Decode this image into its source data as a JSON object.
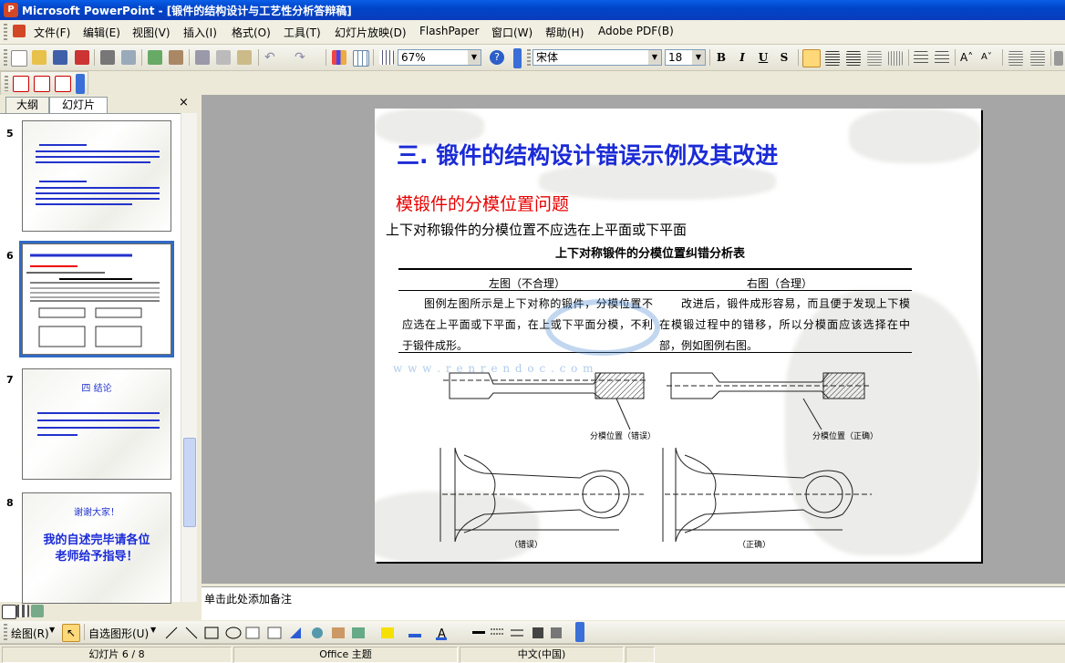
{
  "window": {
    "title": "Microsoft PowerPoint - [锻件的结构设计与工艺性分析答辩稿]"
  },
  "menu": [
    "文件(F)",
    "编辑(E)",
    "视图(V)",
    "插入(I)",
    "格式(O)",
    "工具(T)",
    "幻灯片放映(D)",
    "FlashPaper",
    "窗口(W)",
    "帮助(H)",
    "Adobe PDF(B)"
  ],
  "toolbar": {
    "zoom": "67%",
    "font": "宋体",
    "font_size": "18"
  },
  "format_buttons": {
    "bold": "B",
    "italic": "I",
    "underline": "U",
    "shadow": "S"
  },
  "pane_tabs": {
    "outline": "大纲",
    "slides": "幻灯片"
  },
  "thumbnails": [
    {
      "num": "5"
    },
    {
      "num": "6"
    },
    {
      "num": "7",
      "title": "四 结论"
    },
    {
      "num": "8",
      "line1": "谢谢大家！",
      "line2": "我的自述完毕请各位",
      "line3": "老师给予指导！"
    }
  ],
  "slide": {
    "title": "三. 锻件的结构设计错误示例及其改进",
    "subtitle": "模锻件的分模位置问题",
    "intro": "上下对称锻件的分模位置不应选在上平面或下平面",
    "table_title": "上下对称锻件的分模位置纠错分析表",
    "col_left": "左图（不合理）",
    "col_right": "右图（合理）",
    "left_text": "图例左图所示是上下对称的锻件，分模位置不应选在上平面或下平面，在上或下平面分模，不利于锻件成形。",
    "right_text": "改进后，锻件成形容易，而且便于发现上下模在模锻过程中的错移，所以分模面应该选择在中部，例如图例右图。",
    "label_wrong_pos": "分模位置（错误）",
    "label_right_pos": "分模位置（正确）",
    "caption_wrong": "（错误）",
    "caption_right": "（正确）",
    "watermark": "w w w . r e n r e n d o c . c o m"
  },
  "notes": {
    "placeholder": "单击此处添加备注"
  },
  "drawbar": {
    "draw": "绘图(R)",
    "autoshapes": "自选图形(U)"
  },
  "status": {
    "slide": "幻灯片 6 / 8",
    "theme": "Office 主题",
    "lang": "中文(中国)"
  }
}
